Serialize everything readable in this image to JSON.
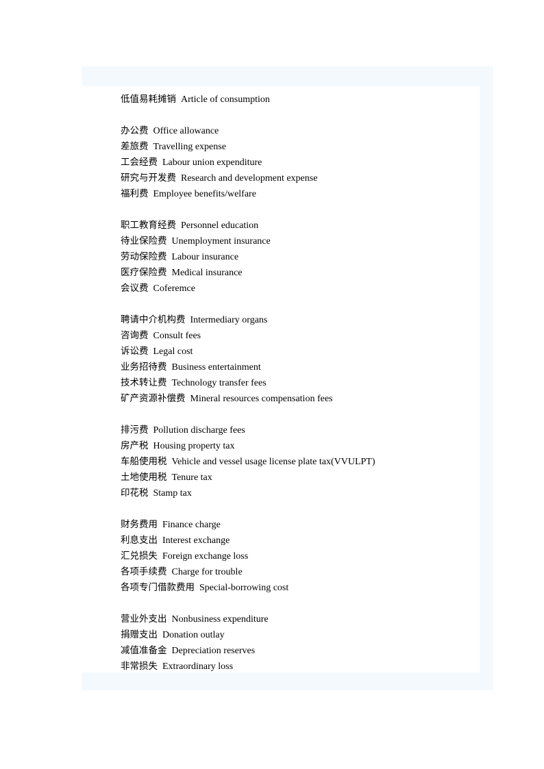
{
  "page": {
    "sheet_color": "#f4f9fd",
    "content_color": "#ffffff",
    "canvas_color": "#ffffff",
    "text_color": "#000000"
  },
  "glossary": {
    "groups": [
      {
        "entries": [
          {
            "cn": "低值易耗摊销",
            "en": "Article of consumption"
          }
        ]
      },
      {
        "entries": [
          {
            "cn": "办公费",
            "en": "Office allowance"
          },
          {
            "cn": "差旅费",
            "en": "Travelling expense"
          },
          {
            "cn": "工会经费",
            "en": "Labour union expenditure"
          },
          {
            "cn": "研究与开发费",
            "en": "Research and development expense"
          },
          {
            "cn": "福利费",
            "en": "Employee benefits/welfare"
          }
        ]
      },
      {
        "entries": [
          {
            "cn": "职工教育经费",
            "en": "Personnel education"
          },
          {
            "cn": "待业保险费",
            "en": "Unemployment insurance"
          },
          {
            "cn": "劳动保险费",
            "en": "Labour insurance"
          },
          {
            "cn": "医疗保险费",
            "en": "Medical insurance"
          },
          {
            "cn": "会议费",
            "en": "Coferemce"
          }
        ]
      },
      {
        "entries": [
          {
            "cn": "聘请中介机构费",
            "en": "Intermediary organs"
          },
          {
            "cn": "咨询费",
            "en": "Consult fees"
          },
          {
            "cn": "诉讼费",
            "en": "Legal cost"
          },
          {
            "cn": "业务招待费",
            "en": "Business entertainment"
          },
          {
            "cn": "技术转让费",
            "en": "Technology transfer fees"
          },
          {
            "cn": "矿产资源补偿费",
            "en": "Mineral resources compensation fees"
          }
        ]
      },
      {
        "entries": [
          {
            "cn": "排污费",
            "en": "Pollution discharge fees"
          },
          {
            "cn": "房产税",
            "en": "Housing property tax"
          },
          {
            "cn": "车船使用税",
            "en": "Vehicle and vessel usage license plate tax(VVULPT)"
          },
          {
            "cn": "土地使用税",
            "en": "Tenure tax"
          },
          {
            "cn": "印花税",
            "en": "Stamp tax"
          }
        ]
      },
      {
        "entries": [
          {
            "cn": "财务费用",
            "en": "Finance charge"
          },
          {
            "cn": "利息支出",
            "en": "Interest exchange"
          },
          {
            "cn": "汇兑损失",
            "en": "Foreign exchange loss"
          },
          {
            "cn": "各项手续费",
            "en": "Charge for trouble"
          },
          {
            "cn": "各项专门借款费用",
            "en": "Special-borrowing cost"
          }
        ]
      },
      {
        "entries": [
          {
            "cn": "营业外支出",
            "en": "Nonbusiness expenditure"
          },
          {
            "cn": "捐赠支出",
            "en": "Donation outlay"
          },
          {
            "cn": "减值准备金",
            "en": "Depreciation reserves"
          },
          {
            "cn": "非常损失",
            "en": "Extraordinary loss"
          }
        ]
      }
    ]
  }
}
